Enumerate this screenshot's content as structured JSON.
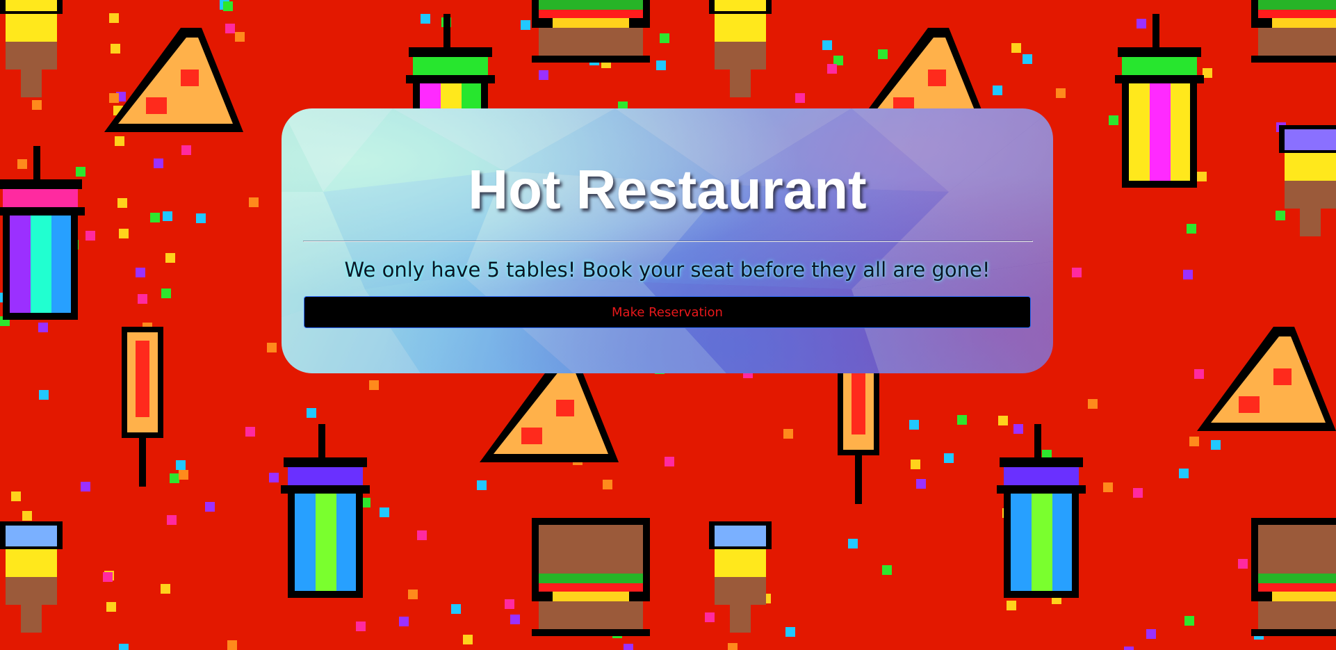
{
  "page": {
    "background_color": "#e31800",
    "background_pattern": "pixel-art-food-pattern"
  },
  "hero": {
    "title": "Hot Restaurant",
    "tagline": "We only have 5 tables! Book your seat before they all are gone!",
    "reservation_button_label": "Make Reservation"
  },
  "colors": {
    "title_text": "#ffffff",
    "tagline_glow": "#78ffff",
    "button_background": "#000000",
    "button_text": "#e8181b",
    "button_border": "#2d6bff"
  }
}
